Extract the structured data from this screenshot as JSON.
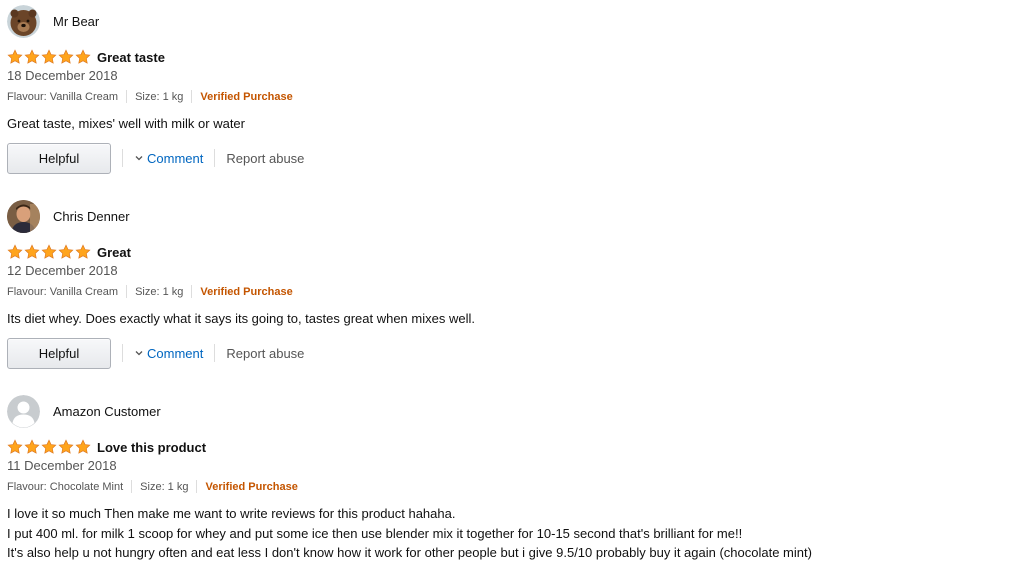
{
  "reviews": [
    {
      "profile_name": "Mr Bear",
      "avatar": "bear-avatar",
      "stars": 5,
      "title": "Great taste",
      "date": "18 December 2018",
      "flavour": "Flavour: Vanilla Cream",
      "size": "Size: 1 kg",
      "verified": "Verified Purchase",
      "body": [
        "Great taste, mixes' well with milk or water"
      ],
      "helpful_label": "Helpful",
      "comment_label": "Comment",
      "report_label": "Report abuse"
    },
    {
      "profile_name": "Chris Denner",
      "avatar": "person-photo-avatar",
      "stars": 5,
      "title": "Great",
      "date": "12 December 2018",
      "flavour": "Flavour: Vanilla Cream",
      "size": "Size: 1 kg",
      "verified": "Verified Purchase",
      "body": [
        "Its diet whey. Does exactly what it says its going to, tastes great when mixes well."
      ],
      "helpful_label": "Helpful",
      "comment_label": "Comment",
      "report_label": "Report abuse"
    },
    {
      "profile_name": "Amazon Customer",
      "avatar": "default-user-avatar",
      "stars": 5,
      "title": "Love this product",
      "date": "11 December 2018",
      "flavour": "Flavour: Chocolate Mint",
      "size": "Size: 1 kg",
      "verified": "Verified Purchase",
      "body": [
        "I love it so much Then make me want to write reviews for this product hahaha.",
        "I put 400 ml. for milk 1 scoop for whey and put some ice then use blender mix it together for 10-15 second that's brilliant for me!!",
        "It's also help u not hungry often and eat less I don't know how it work for other people but i give 9.5/10 probably buy it again (chocolate mint)"
      ]
    }
  ],
  "colors": {
    "star": "#ffa41c",
    "star_stroke": "#de7921",
    "verified": "#c45500",
    "link": "#0066c0",
    "muted": "#555555"
  }
}
